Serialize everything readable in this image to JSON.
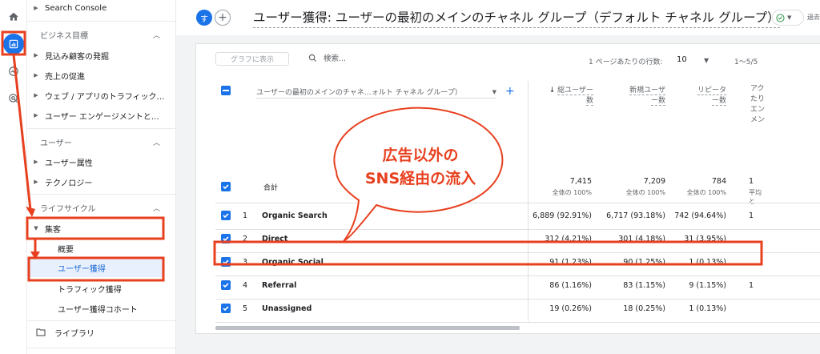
{
  "sidebar": {
    "top_item": "Search Console",
    "sections": [
      {
        "title": "ビジネス目標",
        "items": [
          "見込み顧客の発掘",
          "売上の促進",
          "ウェブ / アプリのトラフィック…",
          "ユーザー エンゲージメントと…"
        ]
      },
      {
        "title": "ユーザー",
        "items": [
          "ユーザー属性",
          "テクノロジー"
        ]
      },
      {
        "title": "ライフサイクル",
        "expanded_item": "集客",
        "sub_items": [
          "概要",
          "ユーザー獲得",
          "トラフィック獲得",
          "ユーザー獲得コホート"
        ],
        "selected_sub": "ユーザー獲得"
      }
    ],
    "library": "ライブラリ"
  },
  "header": {
    "avatar_letter": "す",
    "title": "ユーザー獲得: ユーザーの最初のメインのチャネル グループ（デフォルト チャネル グループ）",
    "past_label": "過去"
  },
  "toolbar": {
    "graph_button": "グラフに表示",
    "search_placeholder": "検索...",
    "rows_per_page_label": "1 ページあたりの行数:",
    "rows_per_page_value": "10",
    "pagination": "1〜5/5"
  },
  "table": {
    "dimension_select": "ユーザーの最初のメインのチャネ…ォルト チャネル グループ）",
    "columns": [
      {
        "line1": "総ユーザー",
        "line2": "数"
      },
      {
        "line1": "新規ユーザ",
        "line2": "ー数"
      },
      {
        "line1": "リピータ",
        "line2": "ー数"
      }
    ],
    "truncated_col_chars": "アク\nたり\nエン\nメン",
    "total": {
      "label": "合計",
      "values": [
        "7,415",
        "7,209",
        "784",
        "1"
      ],
      "subs": [
        "全体の 100%",
        "全体の 100%",
        "全体の 100%",
        "平均と"
      ]
    },
    "rows": [
      {
        "num": "1",
        "name": "Organic Search",
        "v1": "6,889 (92.91%)",
        "v2": "6,717 (93.18%)",
        "v3": "742 (94.64%)",
        "v4": "1"
      },
      {
        "num": "2",
        "name": "Direct",
        "v1": "312 (4.21%)",
        "v2": "301 (4.18%)",
        "v3": "31 (3.95%)",
        "v4": ""
      },
      {
        "num": "3",
        "name": "Organic Social",
        "v1": "91 (1.23%)",
        "v2": "90 (1.25%)",
        "v3": "1 (0.13%)",
        "v4": ""
      },
      {
        "num": "4",
        "name": "Referral",
        "v1": "86 (1.16%)",
        "v2": "83 (1.15%)",
        "v3": "9 (1.15%)",
        "v4": "1"
      },
      {
        "num": "5",
        "name": "Unassigned",
        "v1": "19 (0.26%)",
        "v2": "18 (0.25%)",
        "v3": "1 (0.13%)",
        "v4": ""
      }
    ]
  },
  "annotation": {
    "callout_line1": "広告以外の",
    "callout_line2": "SNS経由の流入",
    "color": "#e8401f"
  }
}
